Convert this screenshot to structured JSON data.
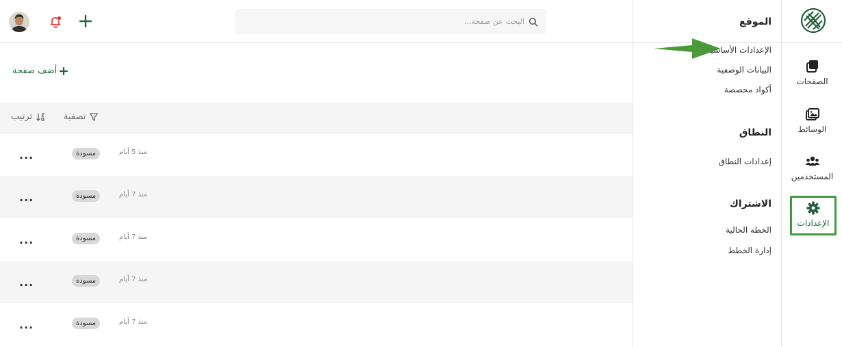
{
  "search": {
    "placeholder": "البحث عن صفحة..."
  },
  "add_page": {
    "label": "أضف صفحة"
  },
  "toolbar": {
    "filter_label": "تصفية",
    "sort_label": "ترتيب"
  },
  "pages": [
    {
      "time": "منذ 5 أيام",
      "status": "مسودة",
      "more": "..."
    },
    {
      "time": "منذ 7 أيام",
      "status": "مسودة",
      "more": "..."
    },
    {
      "time": "منذ 7 أيام",
      "status": "مسودة",
      "more": "..."
    },
    {
      "time": "منذ 7 أيام",
      "status": "مسودة",
      "more": "..."
    },
    {
      "time": "منذ 7 أيام",
      "status": "مسودة",
      "more": "..."
    }
  ],
  "submenu": {
    "site": {
      "heading": "الموقع",
      "links": [
        "الإعدادات الأساسية",
        "البيانات الوصفية",
        "أكواد مخصصة"
      ]
    },
    "domain": {
      "heading": "النطاق",
      "links": [
        "إعدادات النطاق"
      ]
    },
    "subscription": {
      "heading": "الاشتراك",
      "links": [
        "الخطة الحالية",
        "إدارة الخطط"
      ]
    }
  },
  "rail": {
    "items": [
      {
        "label": "الصفحات",
        "icon": "pages-icon"
      },
      {
        "label": "الوسائط",
        "icon": "media-icon"
      },
      {
        "label": "المستخدمين",
        "icon": "users-icon"
      },
      {
        "label": "الإعدادات",
        "icon": "gear-icon",
        "active": true
      }
    ]
  },
  "colors": {
    "brand_green": "#1d6b3d",
    "highlight_green": "#3e9b3f",
    "alert_red": "#e53935",
    "badge_gray": "#d8d8d8"
  }
}
